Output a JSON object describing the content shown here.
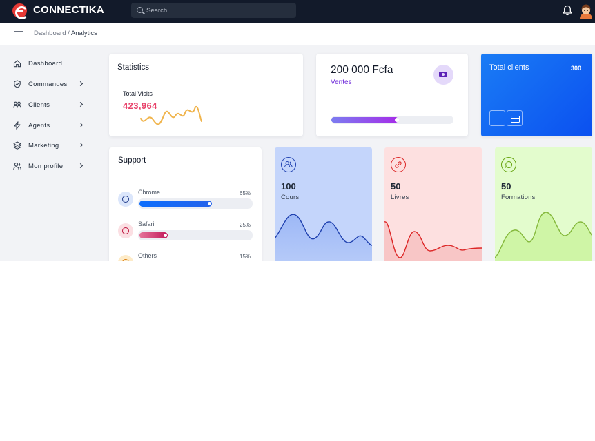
{
  "app": {
    "name": "CONNECTIKA"
  },
  "search": {
    "placeholder": "Search..."
  },
  "breadcrumb": {
    "root": "Dashboard",
    "separator": "/",
    "current": "Analytics"
  },
  "sidebar": {
    "items": [
      {
        "label": "Dashboard",
        "icon": "home-icon",
        "has_submenu": false
      },
      {
        "label": "Commandes",
        "icon": "shield-icon",
        "has_submenu": true
      },
      {
        "label": "Clients",
        "icon": "users-icon",
        "has_submenu": true
      },
      {
        "label": "Agents",
        "icon": "lightning-icon",
        "has_submenu": true
      },
      {
        "label": "Marketing",
        "icon": "layers-icon",
        "has_submenu": true
      },
      {
        "label": "Mon profile",
        "icon": "user-icon",
        "has_submenu": true
      }
    ]
  },
  "statistics": {
    "title": "Statistics",
    "total_visits_label": "Total Visits",
    "total_visits_value": "423,964"
  },
  "sales": {
    "amount": "200 000 Fcfa",
    "label": "Ventes",
    "progress": 0.55
  },
  "clients": {
    "title": "Total clients",
    "count": "300"
  },
  "support": {
    "title": "Support",
    "items": [
      {
        "name": "Chrome",
        "percent": "65%",
        "value": 0.65,
        "color": "#0d6efd",
        "icon": "chrome-icon"
      },
      {
        "name": "Safari",
        "percent": "25%",
        "value": 0.25,
        "color": "#d63384",
        "icon": "compass-icon"
      },
      {
        "name": "Others",
        "percent": "15%",
        "value": 0.15,
        "color": "#f59e0b",
        "icon": "globe-icon"
      }
    ]
  },
  "mini_cards": [
    {
      "value": "100",
      "label": "Cours",
      "icon": "users-icon",
      "color": "#1e40af"
    },
    {
      "value": "50",
      "label": "Livres",
      "icon": "link-icon",
      "color": "#dc2626"
    },
    {
      "value": "50",
      "label": "Formations",
      "icon": "chat-icon",
      "color": "#65a30d"
    }
  ],
  "colors": {
    "topbar": "#121a2a",
    "accent_blue": "#0b50f0",
    "visits_value": "#e8436b",
    "ventes": "#6d28d9"
  }
}
